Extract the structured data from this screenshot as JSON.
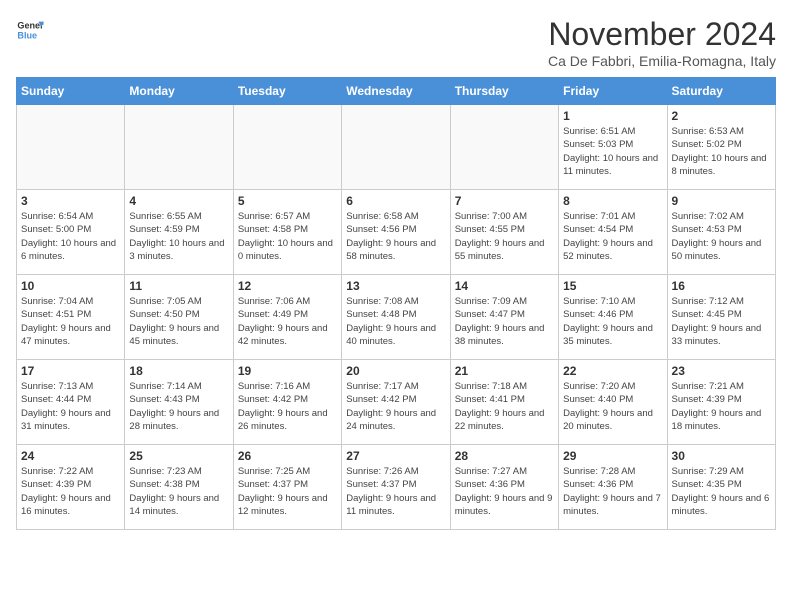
{
  "header": {
    "logo_line1": "General",
    "logo_line2": "Blue",
    "month": "November 2024",
    "location": "Ca De Fabbri, Emilia-Romagna, Italy"
  },
  "days_of_week": [
    "Sunday",
    "Monday",
    "Tuesday",
    "Wednesday",
    "Thursday",
    "Friday",
    "Saturday"
  ],
  "weeks": [
    [
      {
        "day": "",
        "info": ""
      },
      {
        "day": "",
        "info": ""
      },
      {
        "day": "",
        "info": ""
      },
      {
        "day": "",
        "info": ""
      },
      {
        "day": "",
        "info": ""
      },
      {
        "day": "1",
        "info": "Sunrise: 6:51 AM\nSunset: 5:03 PM\nDaylight: 10 hours and 11 minutes."
      },
      {
        "day": "2",
        "info": "Sunrise: 6:53 AM\nSunset: 5:02 PM\nDaylight: 10 hours and 8 minutes."
      }
    ],
    [
      {
        "day": "3",
        "info": "Sunrise: 6:54 AM\nSunset: 5:00 PM\nDaylight: 10 hours and 6 minutes."
      },
      {
        "day": "4",
        "info": "Sunrise: 6:55 AM\nSunset: 4:59 PM\nDaylight: 10 hours and 3 minutes."
      },
      {
        "day": "5",
        "info": "Sunrise: 6:57 AM\nSunset: 4:58 PM\nDaylight: 10 hours and 0 minutes."
      },
      {
        "day": "6",
        "info": "Sunrise: 6:58 AM\nSunset: 4:56 PM\nDaylight: 9 hours and 58 minutes."
      },
      {
        "day": "7",
        "info": "Sunrise: 7:00 AM\nSunset: 4:55 PM\nDaylight: 9 hours and 55 minutes."
      },
      {
        "day": "8",
        "info": "Sunrise: 7:01 AM\nSunset: 4:54 PM\nDaylight: 9 hours and 52 minutes."
      },
      {
        "day": "9",
        "info": "Sunrise: 7:02 AM\nSunset: 4:53 PM\nDaylight: 9 hours and 50 minutes."
      }
    ],
    [
      {
        "day": "10",
        "info": "Sunrise: 7:04 AM\nSunset: 4:51 PM\nDaylight: 9 hours and 47 minutes."
      },
      {
        "day": "11",
        "info": "Sunrise: 7:05 AM\nSunset: 4:50 PM\nDaylight: 9 hours and 45 minutes."
      },
      {
        "day": "12",
        "info": "Sunrise: 7:06 AM\nSunset: 4:49 PM\nDaylight: 9 hours and 42 minutes."
      },
      {
        "day": "13",
        "info": "Sunrise: 7:08 AM\nSunset: 4:48 PM\nDaylight: 9 hours and 40 minutes."
      },
      {
        "day": "14",
        "info": "Sunrise: 7:09 AM\nSunset: 4:47 PM\nDaylight: 9 hours and 38 minutes."
      },
      {
        "day": "15",
        "info": "Sunrise: 7:10 AM\nSunset: 4:46 PM\nDaylight: 9 hours and 35 minutes."
      },
      {
        "day": "16",
        "info": "Sunrise: 7:12 AM\nSunset: 4:45 PM\nDaylight: 9 hours and 33 minutes."
      }
    ],
    [
      {
        "day": "17",
        "info": "Sunrise: 7:13 AM\nSunset: 4:44 PM\nDaylight: 9 hours and 31 minutes."
      },
      {
        "day": "18",
        "info": "Sunrise: 7:14 AM\nSunset: 4:43 PM\nDaylight: 9 hours and 28 minutes."
      },
      {
        "day": "19",
        "info": "Sunrise: 7:16 AM\nSunset: 4:42 PM\nDaylight: 9 hours and 26 minutes."
      },
      {
        "day": "20",
        "info": "Sunrise: 7:17 AM\nSunset: 4:42 PM\nDaylight: 9 hours and 24 minutes."
      },
      {
        "day": "21",
        "info": "Sunrise: 7:18 AM\nSunset: 4:41 PM\nDaylight: 9 hours and 22 minutes."
      },
      {
        "day": "22",
        "info": "Sunrise: 7:20 AM\nSunset: 4:40 PM\nDaylight: 9 hours and 20 minutes."
      },
      {
        "day": "23",
        "info": "Sunrise: 7:21 AM\nSunset: 4:39 PM\nDaylight: 9 hours and 18 minutes."
      }
    ],
    [
      {
        "day": "24",
        "info": "Sunrise: 7:22 AM\nSunset: 4:39 PM\nDaylight: 9 hours and 16 minutes."
      },
      {
        "day": "25",
        "info": "Sunrise: 7:23 AM\nSunset: 4:38 PM\nDaylight: 9 hours and 14 minutes."
      },
      {
        "day": "26",
        "info": "Sunrise: 7:25 AM\nSunset: 4:37 PM\nDaylight: 9 hours and 12 minutes."
      },
      {
        "day": "27",
        "info": "Sunrise: 7:26 AM\nSunset: 4:37 PM\nDaylight: 9 hours and 11 minutes."
      },
      {
        "day": "28",
        "info": "Sunrise: 7:27 AM\nSunset: 4:36 PM\nDaylight: 9 hours and 9 minutes."
      },
      {
        "day": "29",
        "info": "Sunrise: 7:28 AM\nSunset: 4:36 PM\nDaylight: 9 hours and 7 minutes."
      },
      {
        "day": "30",
        "info": "Sunrise: 7:29 AM\nSunset: 4:35 PM\nDaylight: 9 hours and 6 minutes."
      }
    ]
  ]
}
